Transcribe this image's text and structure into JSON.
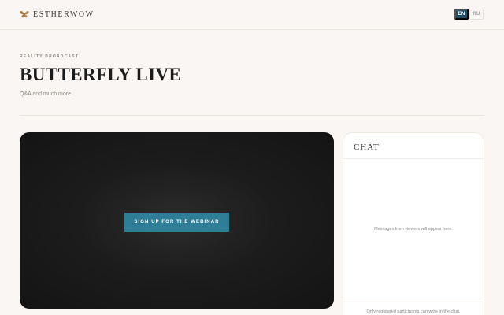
{
  "header": {
    "brand": "ESTHERWOW",
    "brand_icon": "butterfly-icon",
    "languages": [
      "EN",
      "RU"
    ],
    "active_language": "EN"
  },
  "hero": {
    "eyebrow": "REALITY BROADCAST",
    "title": "BUTTERFLY LIVE",
    "subtitle": "Q&A and much more"
  },
  "player": {
    "signup_label": "SIGN UP FOR THE WEBINAR"
  },
  "chat": {
    "title": "CHAT",
    "empty_message": "Messages from viewers will appear here.",
    "note": "Only registered participants can write in the chat."
  },
  "colors": {
    "page_bg": "#faf6f3",
    "accent": "#2e7e97",
    "active_lang": "#1e4f66",
    "player_bg": "#141414"
  }
}
